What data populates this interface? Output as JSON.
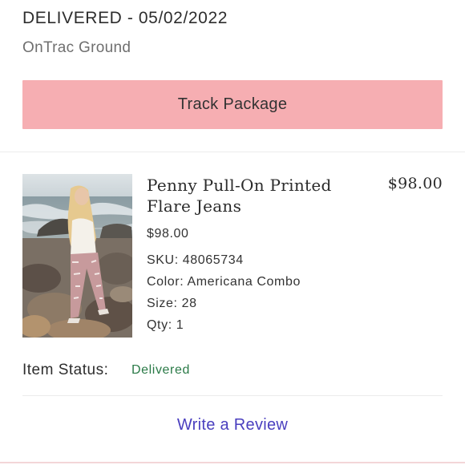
{
  "order": {
    "status_line": "DELIVERED - 05/02/2022",
    "carrier": "OnTrac Ground",
    "track_button_label": "Track Package"
  },
  "item": {
    "name": "Penny Pull-On Printed Flare Jeans",
    "line_price": "$98.00",
    "unit_price": "$98.00",
    "sku": "SKU: 48065734",
    "color": "Color: Americana Combo",
    "size": "Size: 28",
    "qty": "Qty: 1",
    "image_icon": "product-photo",
    "status_label": "Item Status:",
    "status_value": "Delivered"
  },
  "actions": {
    "review_label": "Write a Review"
  },
  "colors": {
    "track_button_bg": "#f6aeb2",
    "status_green": "#2a7a47",
    "review_link": "#4a3fbf"
  }
}
